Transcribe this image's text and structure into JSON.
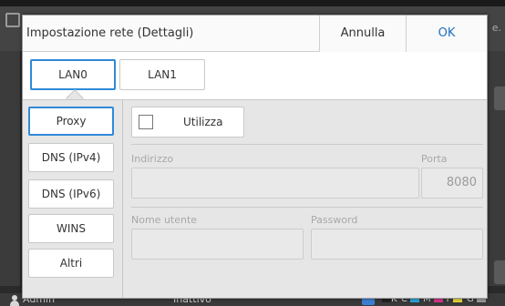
{
  "background": {
    "corner_text": "e.",
    "status_user": "Admin",
    "status_state": "Inattivo",
    "ink": [
      {
        "letter": "K",
        "color": "#222222"
      },
      {
        "letter": "C",
        "color": "#2aa6dc"
      },
      {
        "letter": "M",
        "color": "#d8358a"
      },
      {
        "letter": "Y",
        "color": "#e9d63a"
      },
      {
        "letter": "G",
        "color": "#9a9a9a"
      }
    ]
  },
  "dialog": {
    "title": "Impostazione rete (Dettagli)",
    "cancel_label": "Annulla",
    "ok_label": "OK",
    "tabs": [
      {
        "label": "LAN0",
        "active": true
      },
      {
        "label": "LAN1",
        "active": false
      }
    ],
    "side_items": [
      {
        "label": "Proxy",
        "active": true
      },
      {
        "label": "DNS (IPv4)",
        "active": false
      },
      {
        "label": "DNS (IPv6)",
        "active": false
      },
      {
        "label": "WINS",
        "active": false
      },
      {
        "label": "Altri",
        "active": false
      }
    ],
    "use_label": "Utilizza",
    "use_checked": false,
    "fields": {
      "address_label": "Indirizzo",
      "address_value": "",
      "port_label": "Porta",
      "port_value": "8080",
      "username_label": "Nome utente",
      "username_value": "",
      "password_label": "Password",
      "password_value": ""
    },
    "colors": {
      "accent": "#2f8ad8",
      "ok_text": "#1f6fc0"
    }
  }
}
